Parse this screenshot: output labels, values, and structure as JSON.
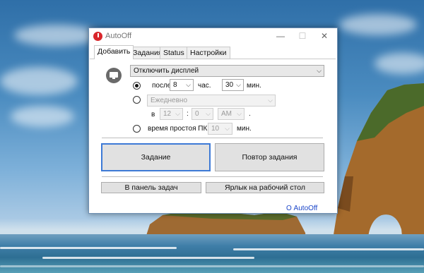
{
  "window": {
    "title": "AutoOff",
    "controls": {
      "minimize": "—",
      "maximize": "☐",
      "close": "✕"
    }
  },
  "tabs": [
    {
      "label": "Добавить",
      "active": true
    },
    {
      "label": "Задания",
      "active": false
    },
    {
      "label": "Status",
      "active": false
    },
    {
      "label": "Настройки",
      "active": false
    }
  ],
  "action": {
    "selected": "Отключить дисплей"
  },
  "after": {
    "label": "после",
    "hours": "8",
    "hours_unit": "час.",
    "minutes": "30",
    "minutes_unit": "мин."
  },
  "schedule": {
    "period": "Ежедневно",
    "at_label": "в",
    "hour": "12",
    "colon": ":",
    "minute": "0",
    "ampm": "AM",
    "dot": "."
  },
  "idle": {
    "label": "время простоя ПК",
    "value": "10",
    "unit": "мин."
  },
  "buttons": {
    "task": "Задание",
    "repeat": "Повтор задания",
    "tray": "В панель задач",
    "shortcut": "Ярлык на рабочий стол"
  },
  "footer": {
    "link": "О AutoOff"
  },
  "icons": {
    "app": "power-icon",
    "monitor": "monitor-icon",
    "dropdown": "chevron-down-icon"
  }
}
